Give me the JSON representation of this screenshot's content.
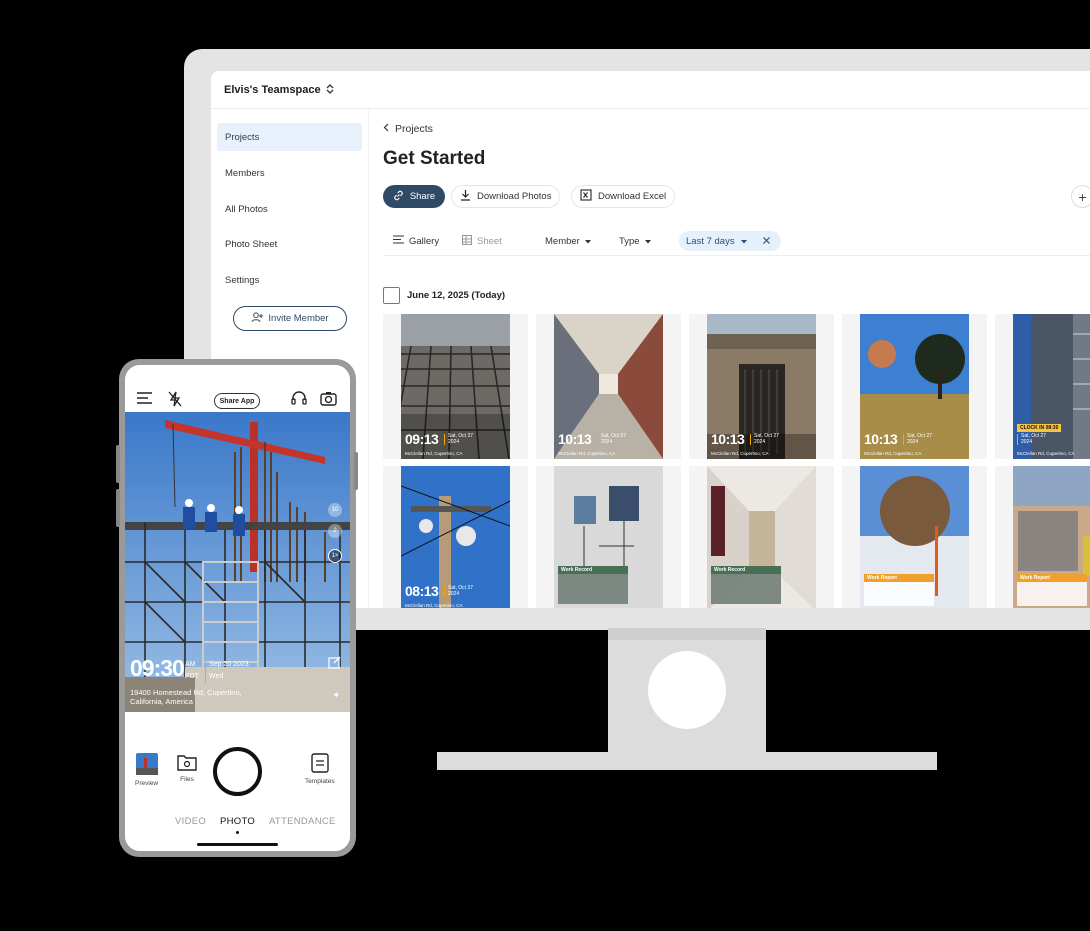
{
  "desktop": {
    "teamspace": "Elvis's Teamspace",
    "sidebar": {
      "items": [
        {
          "label": "Projects",
          "active": true
        },
        {
          "label": "Members",
          "active": false
        },
        {
          "label": "All Photos",
          "active": false
        },
        {
          "label": "Photo Sheet",
          "active": false
        },
        {
          "label": "Settings",
          "active": false
        }
      ],
      "invite_label": "Invite Member"
    },
    "breadcrumb": "Projects",
    "title": "Get Started",
    "toolbar": {
      "share_label": "Share",
      "download_photos_label": "Download Photos",
      "download_excel_label": "Download Excel"
    },
    "filters": {
      "gallery_label": "Gallery",
      "sheet_label": "Sheet",
      "member_label": "Member",
      "type_label": "Type",
      "date_chip_label": "Last 7 days"
    },
    "date_group_label": "June 12, 2025 (Today)",
    "photos": [
      {
        "time": "09:13",
        "date": [
          "Sat, Oct 27",
          "2024"
        ],
        "address": "McClellan Rd, Cupertino, CA"
      },
      {
        "time": "10:13",
        "date": [
          "Sat, Oct 27",
          "2024"
        ],
        "address": "McClellan Rd, Cupertino, CA"
      },
      {
        "time": "10:13",
        "date": [
          "Sat, Oct 27",
          "2024"
        ],
        "address": "McClellan Rd, Cupertino, CA"
      },
      {
        "time": "10:13",
        "date": [
          "Sat, Oct 27",
          "2024"
        ],
        "address": "McClellan Rd, Cupertino, CA"
      },
      {
        "badge": "CLOCK IN",
        "badge_time": "08:30",
        "date": [
          "Sat, Oct 27",
          "2024"
        ],
        "address": "McClellan Rd, Cupertino, CA"
      },
      {
        "time": "08:13",
        "date": [
          "Sat, Oct 27",
          "2024"
        ],
        "address": "McClellan Rd, Cupertino, CA"
      },
      {
        "report_title": "Work Record"
      },
      {
        "report_title": "Work Record"
      },
      {
        "report_title": "Work Report"
      },
      {
        "report_title": "Work Report"
      }
    ]
  },
  "phone": {
    "share_app_label": "Share App",
    "zoom_levels": [
      "10",
      "2",
      "1×"
    ],
    "time": "09:30",
    "ampm": "AM",
    "tz": "PDT",
    "date": "Sep 20 2023",
    "weekday": "Wed",
    "address_line1": "19400 Homestead Rd, Cupertino,",
    "address_line2": "California, America",
    "preview_label": "Preview",
    "files_label": "Files",
    "templates_label": "Templates",
    "modes": [
      "VIDEO",
      "PHOTO",
      "ATTENDANCE"
    ],
    "active_mode": "PHOTO"
  },
  "colors": {
    "accent": "#2f4a66",
    "chip_bg": "#e6f0fb",
    "watermark_bar": "#f2a900",
    "report_orange": "#f0a12c"
  }
}
